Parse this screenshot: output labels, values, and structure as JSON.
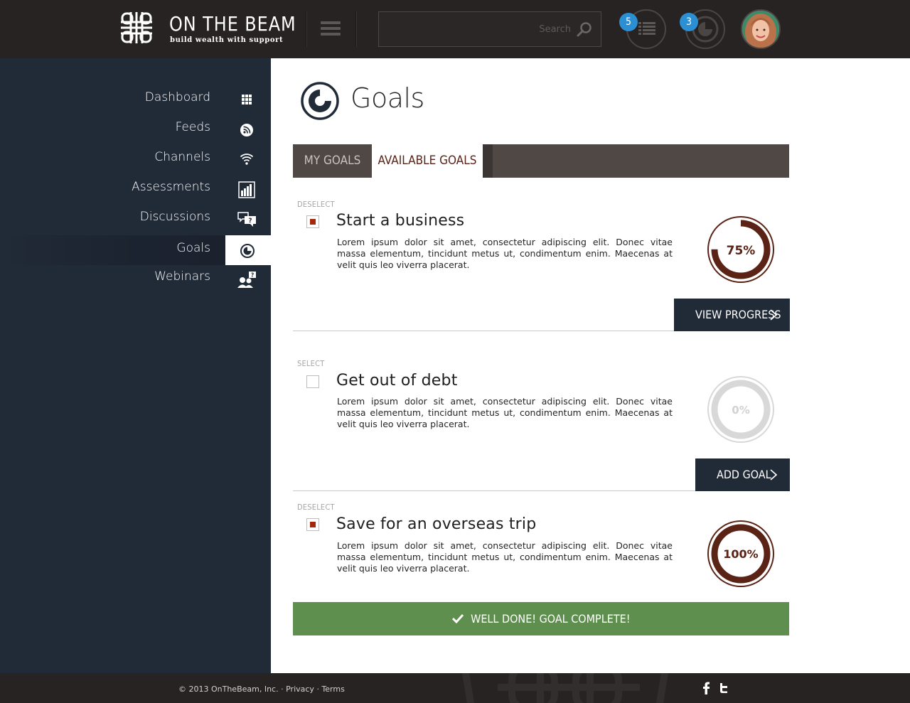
{
  "header": {
    "logo_title": "ON THE BEAM",
    "logo_tagline": "build wealth with support",
    "search_placeholder": "Search",
    "notifications": [
      {
        "name": "feed-list",
        "count": "5"
      },
      {
        "name": "goals",
        "count": "3"
      }
    ]
  },
  "sidebar": {
    "items": [
      {
        "label": "Dashboard",
        "icon": "grid-icon",
        "active": false
      },
      {
        "label": "Feeds",
        "icon": "rss-icon",
        "active": false
      },
      {
        "label": "Channels",
        "icon": "wifi-icon",
        "active": false
      },
      {
        "label": "Assessments",
        "icon": "bar-chart-icon",
        "active": false
      },
      {
        "label": "Discussions",
        "icon": "chat-question-icon",
        "active": false
      },
      {
        "label": "Goals",
        "icon": "goal-ring-icon",
        "active": true
      },
      {
        "label": "Webinars",
        "icon": "presenter-icon",
        "active": false
      }
    ]
  },
  "main": {
    "title": "Goals",
    "tabs": [
      {
        "label": "MY GOALS",
        "active": false
      },
      {
        "label": "AVAILABLE GOALS",
        "active": true
      }
    ],
    "goals": [
      {
        "select_label": "DESELECT",
        "checked": true,
        "title": "Start a business",
        "description": "Lorem ipsum dolor sit amet, consectetur adipiscing elit. Donec vitae massa elementum, tincidunt metus ut, condimentum enim. Maecenas at velit quis leo viverra placerat.",
        "progress": 0.75,
        "progress_label": "75%",
        "action_label": "VIEW PROGRESS"
      },
      {
        "select_label": "SELECT",
        "checked": false,
        "title": "Get out of debt",
        "description": "Lorem ipsum dolor sit amet, consectetur adipiscing elit. Donec vitae massa elementum, tincidunt metus ut, condimentum enim. Maecenas at velit quis leo viverra placerat.",
        "progress": 0,
        "progress_label": "0%",
        "action_label": "ADD GOAL"
      },
      {
        "select_label": "DESELECT",
        "checked": true,
        "title": "Save for an overseas trip",
        "description": "Lorem ipsum dolor sit amet, consectetur adipiscing elit. Donec vitae massa elementum, tincidunt metus ut, condimentum enim. Maecenas at velit quis leo viverra placerat.",
        "progress": 1,
        "progress_label": "100%",
        "action_label": "WELL DONE! GOAL COMPLETE!"
      }
    ]
  },
  "footer": {
    "copyright": "© 2013 OnTheBeam, Inc.",
    "privacy": "Privacy",
    "terms": "Terms"
  },
  "colors": {
    "header_bg": "#262322",
    "sidebar_bg": "#212a37",
    "accent_brown": "#5a2316",
    "check_red": "#a4290c",
    "success_green": "#5f8f4e",
    "tab_bar": "#4f4845"
  }
}
